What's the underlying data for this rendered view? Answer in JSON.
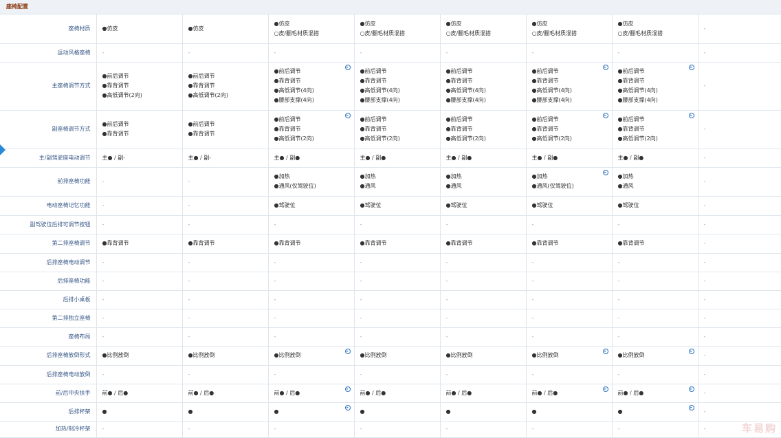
{
  "section": {
    "title": "座椅配置"
  },
  "watermark": "车易购",
  "rows": [
    {
      "label": "座椅材质",
      "cells": [
        {
          "lines": [
            "●仿皮"
          ]
        },
        {
          "lines": [
            "●仿皮"
          ]
        },
        {
          "lines": [
            "●仿皮",
            "○皮/翻毛材质混搭"
          ]
        },
        {
          "lines": [
            "●仿皮",
            "○皮/翻毛材质混搭"
          ]
        },
        {
          "lines": [
            "●仿皮",
            "○皮/翻毛材质混搭"
          ]
        },
        {
          "lines": [
            "●仿皮",
            "○皮/翻毛材质混搭"
          ]
        },
        {
          "lines": [
            "●仿皮",
            "○皮/翻毛材质混搭"
          ]
        },
        {
          "lines": [
            "-"
          ]
        }
      ]
    },
    {
      "label": "运动风格座椅",
      "cells": [
        {
          "lines": [
            "-"
          ]
        },
        {
          "lines": [
            "-"
          ]
        },
        {
          "lines": [
            "-"
          ]
        },
        {
          "lines": [
            "-"
          ]
        },
        {
          "lines": [
            "-"
          ]
        },
        {
          "lines": [
            "-"
          ]
        },
        {
          "lines": [
            "-"
          ]
        },
        {
          "lines": [
            "-"
          ]
        }
      ]
    },
    {
      "label": "主座椅调节方式",
      "cells": [
        {
          "lines": [
            "●前后调节",
            "●靠背调节",
            "●高低调节(2向)"
          ]
        },
        {
          "lines": [
            "●前后调节",
            "●靠背调节",
            "●高低调节(2向)"
          ]
        },
        {
          "badge": true,
          "lines": [
            "●前后调节",
            "●靠背调节",
            "●高低调节(4向)",
            "●腰部支撑(4向)"
          ]
        },
        {
          "lines": [
            "●前后调节",
            "●靠背调节",
            "●高低调节(4向)",
            "●腰部支撑(4向)"
          ]
        },
        {
          "lines": [
            "●前后调节",
            "●靠背调节",
            "●高低调节(4向)",
            "●腰部支撑(4向)"
          ]
        },
        {
          "badge": true,
          "lines": [
            "●前后调节",
            "●靠背调节",
            "●高低调节(4向)",
            "●腰部支撑(4向)"
          ]
        },
        {
          "badge": true,
          "lines": [
            "●前后调节",
            "●靠背调节",
            "●高低调节(4向)",
            "●腰部支撑(4向)"
          ]
        },
        {
          "lines": [
            "-"
          ]
        }
      ]
    },
    {
      "label": "副座椅调节方式",
      "cells": [
        {
          "lines": [
            "●前后调节",
            "●靠背调节"
          ]
        },
        {
          "lines": [
            "●前后调节",
            "●靠背调节"
          ]
        },
        {
          "badge": true,
          "lines": [
            "●前后调节",
            "●靠背调节",
            "●高低调节(2向)"
          ]
        },
        {
          "lines": [
            "●前后调节",
            "●靠背调节",
            "●高低调节(2向)"
          ]
        },
        {
          "lines": [
            "●前后调节",
            "●靠背调节",
            "●高低调节(2向)"
          ]
        },
        {
          "badge": true,
          "lines": [
            "●前后调节",
            "●靠背调节",
            "●高低调节(2向)"
          ]
        },
        {
          "badge": true,
          "lines": [
            "●前后调节",
            "●靠背调节",
            "●高低调节(2向)"
          ]
        },
        {
          "lines": [
            "-"
          ]
        }
      ]
    },
    {
      "label": "主/副驾驶座电动调节",
      "cells": [
        {
          "lines": [
            "主● / 副-"
          ]
        },
        {
          "lines": [
            "主● / 副-"
          ]
        },
        {
          "lines": [
            "主● / 副●"
          ]
        },
        {
          "lines": [
            "主● / 副●"
          ]
        },
        {
          "lines": [
            "主● / 副●"
          ]
        },
        {
          "lines": [
            "主● / 副●"
          ]
        },
        {
          "lines": [
            "主● / 副●"
          ]
        },
        {
          "lines": [
            "-"
          ]
        }
      ]
    },
    {
      "label": "前排座椅功能",
      "cells": [
        {
          "lines": [
            "-"
          ]
        },
        {
          "lines": [
            "-"
          ]
        },
        {
          "lines": [
            "●加热",
            "●通风(仅驾驶位)"
          ]
        },
        {
          "lines": [
            "●加热",
            "●通风"
          ]
        },
        {
          "lines": [
            "●加热",
            "●通风"
          ]
        },
        {
          "badge": true,
          "lines": [
            "●加热",
            "●通风(仅驾驶位)"
          ]
        },
        {
          "lines": [
            "●加热",
            "●通风"
          ]
        },
        {
          "lines": [
            "-"
          ]
        }
      ]
    },
    {
      "label": "电动座椅记忆功能",
      "cells": [
        {
          "lines": [
            "-"
          ]
        },
        {
          "lines": [
            "-"
          ]
        },
        {
          "lines": [
            "●驾驶位"
          ]
        },
        {
          "lines": [
            "●驾驶位"
          ]
        },
        {
          "lines": [
            "●驾驶位"
          ]
        },
        {
          "lines": [
            "●驾驶位"
          ]
        },
        {
          "lines": [
            "●驾驶位"
          ]
        },
        {
          "lines": [
            "-"
          ]
        }
      ]
    },
    {
      "label": "副驾驶位后排可调节按钮",
      "cells": [
        {
          "lines": [
            "-"
          ]
        },
        {
          "lines": [
            "-"
          ]
        },
        {
          "lines": [
            "-"
          ]
        },
        {
          "lines": [
            "-"
          ]
        },
        {
          "lines": [
            "-"
          ]
        },
        {
          "lines": [
            "-"
          ]
        },
        {
          "lines": [
            "-"
          ]
        },
        {
          "lines": [
            "-"
          ]
        }
      ]
    },
    {
      "label": "第二排座椅调节",
      "cells": [
        {
          "lines": [
            "●靠背调节"
          ]
        },
        {
          "lines": [
            "●靠背调节"
          ]
        },
        {
          "lines": [
            "●靠背调节"
          ]
        },
        {
          "lines": [
            "●靠背调节"
          ]
        },
        {
          "lines": [
            "●靠背调节"
          ]
        },
        {
          "lines": [
            "●靠背调节"
          ]
        },
        {
          "lines": [
            "●靠背调节"
          ]
        },
        {
          "lines": [
            "-"
          ]
        }
      ]
    },
    {
      "label": "后排座椅电动调节",
      "cells": [
        {
          "lines": [
            "-"
          ]
        },
        {
          "lines": [
            "-"
          ]
        },
        {
          "lines": [
            "-"
          ]
        },
        {
          "lines": [
            "-"
          ]
        },
        {
          "lines": [
            "-"
          ]
        },
        {
          "lines": [
            "-"
          ]
        },
        {
          "lines": [
            "-"
          ]
        },
        {
          "lines": [
            "-"
          ]
        }
      ]
    },
    {
      "label": "后排座椅功能",
      "cells": [
        {
          "lines": [
            "-"
          ]
        },
        {
          "lines": [
            "-"
          ]
        },
        {
          "lines": [
            "-"
          ]
        },
        {
          "lines": [
            "-"
          ]
        },
        {
          "lines": [
            "-"
          ]
        },
        {
          "lines": [
            "-"
          ]
        },
        {
          "lines": [
            "-"
          ]
        },
        {
          "lines": [
            "-"
          ]
        }
      ]
    },
    {
      "label": "后排小桌板",
      "cells": [
        {
          "lines": [
            "-"
          ]
        },
        {
          "lines": [
            "-"
          ]
        },
        {
          "lines": [
            "-"
          ]
        },
        {
          "lines": [
            "-"
          ]
        },
        {
          "lines": [
            "-"
          ]
        },
        {
          "lines": [
            "-"
          ]
        },
        {
          "lines": [
            "-"
          ]
        },
        {
          "lines": [
            "-"
          ]
        }
      ]
    },
    {
      "label": "第二排独立座椅",
      "cells": [
        {
          "lines": [
            "-"
          ]
        },
        {
          "lines": [
            "-"
          ]
        },
        {
          "lines": [
            "-"
          ]
        },
        {
          "lines": [
            "-"
          ]
        },
        {
          "lines": [
            "-"
          ]
        },
        {
          "lines": [
            "-"
          ]
        },
        {
          "lines": [
            "-"
          ]
        },
        {
          "lines": [
            "-"
          ]
        }
      ]
    },
    {
      "label": "座椅布局",
      "cells": [
        {
          "lines": [
            "-"
          ]
        },
        {
          "lines": [
            "-"
          ]
        },
        {
          "lines": [
            "-"
          ]
        },
        {
          "lines": [
            "-"
          ]
        },
        {
          "lines": [
            "-"
          ]
        },
        {
          "lines": [
            "-"
          ]
        },
        {
          "lines": [
            "-"
          ]
        },
        {
          "lines": [
            "-"
          ]
        }
      ]
    },
    {
      "label": "后排座椅放倒形式",
      "cells": [
        {
          "lines": [
            "●比例放倒"
          ]
        },
        {
          "lines": [
            "●比例放倒"
          ]
        },
        {
          "badge": true,
          "lines": [
            "●比例放倒"
          ]
        },
        {
          "lines": [
            "●比例放倒"
          ]
        },
        {
          "lines": [
            "●比例放倒"
          ]
        },
        {
          "badge": true,
          "lines": [
            "●比例放倒"
          ]
        },
        {
          "badge": true,
          "lines": [
            "●比例放倒"
          ]
        },
        {
          "lines": [
            "-"
          ]
        }
      ]
    },
    {
      "label": "后排座椅电动放倒",
      "cells": [
        {
          "lines": [
            "-"
          ]
        },
        {
          "lines": [
            "-"
          ]
        },
        {
          "lines": [
            "-"
          ]
        },
        {
          "lines": [
            "-"
          ]
        },
        {
          "lines": [
            "-"
          ]
        },
        {
          "lines": [
            "-"
          ]
        },
        {
          "lines": [
            "-"
          ]
        },
        {
          "lines": [
            "-"
          ]
        }
      ]
    },
    {
      "label": "前/后中央扶手",
      "cells": [
        {
          "lines": [
            "前● / 后●"
          ]
        },
        {
          "lines": [
            "前● / 后●"
          ]
        },
        {
          "badge": true,
          "lines": [
            "前● / 后●"
          ]
        },
        {
          "lines": [
            "前● / 后●"
          ]
        },
        {
          "lines": [
            "前● / 后●"
          ]
        },
        {
          "badge": true,
          "lines": [
            "前● / 后●"
          ]
        },
        {
          "badge": true,
          "lines": [
            "前● / 后●"
          ]
        },
        {
          "lines": [
            "-"
          ]
        }
      ]
    },
    {
      "label": "后排杯架",
      "cells": [
        {
          "lines": [
            "●"
          ]
        },
        {
          "lines": [
            "●"
          ]
        },
        {
          "badge": true,
          "lines": [
            "●"
          ]
        },
        {
          "lines": [
            "●"
          ]
        },
        {
          "lines": [
            "●"
          ]
        },
        {
          "lines": [
            "●"
          ]
        },
        {
          "badge": true,
          "lines": [
            "●"
          ]
        },
        {
          "lines": [
            "-"
          ]
        }
      ]
    },
    {
      "label": "加热/制冷杯架",
      "cells": [
        {
          "lines": [
            "-"
          ]
        },
        {
          "lines": [
            "-"
          ]
        },
        {
          "lines": [
            "-"
          ]
        },
        {
          "lines": [
            "-"
          ]
        },
        {
          "lines": [
            "-"
          ]
        },
        {
          "lines": [
            "-"
          ]
        },
        {
          "lines": [
            "-"
          ]
        },
        {
          "lines": [
            "-"
          ]
        }
      ]
    }
  ]
}
